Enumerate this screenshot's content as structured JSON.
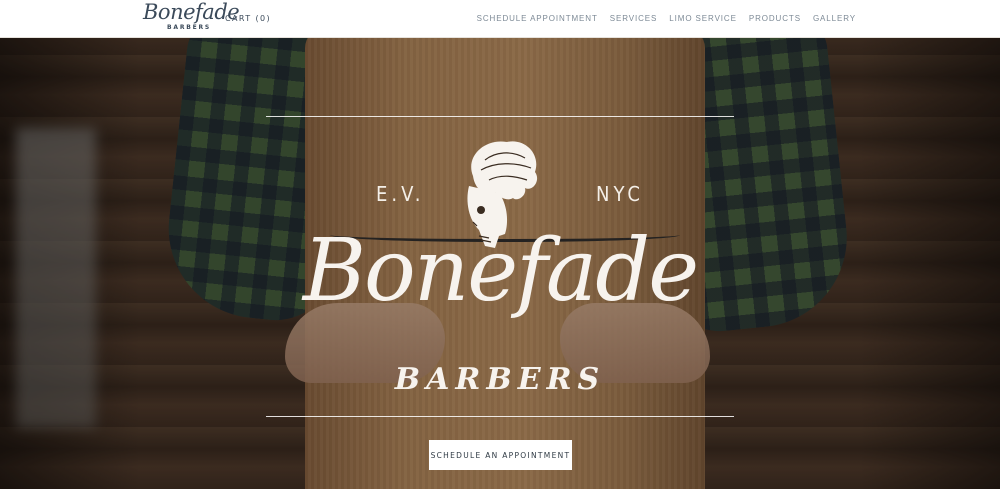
{
  "header": {
    "logo_script": "Bonefade",
    "logo_sub": "BARBERS",
    "cart_label": "CART (0)",
    "nav": [
      {
        "label": "SCHEDULE APPOINTMENT"
      },
      {
        "label": "SERVICES"
      },
      {
        "label": "LIMO SERVICE"
      },
      {
        "label": "PRODUCTS"
      },
      {
        "label": "GALLERY"
      }
    ]
  },
  "hero": {
    "left_text": "E.V.",
    "right_text": "NYC",
    "brand_script": "Bonefade",
    "brand_sub": "BARBERS",
    "cta_label": "SCHEDULE AN APPOINTMENT"
  },
  "colors": {
    "nav_text": "#7d8a96",
    "logo": "#3b4a5a",
    "apron": "#b08558",
    "emblem": "#f7f3ee"
  },
  "icons": {
    "emblem": "skull-pompadour-icon"
  }
}
